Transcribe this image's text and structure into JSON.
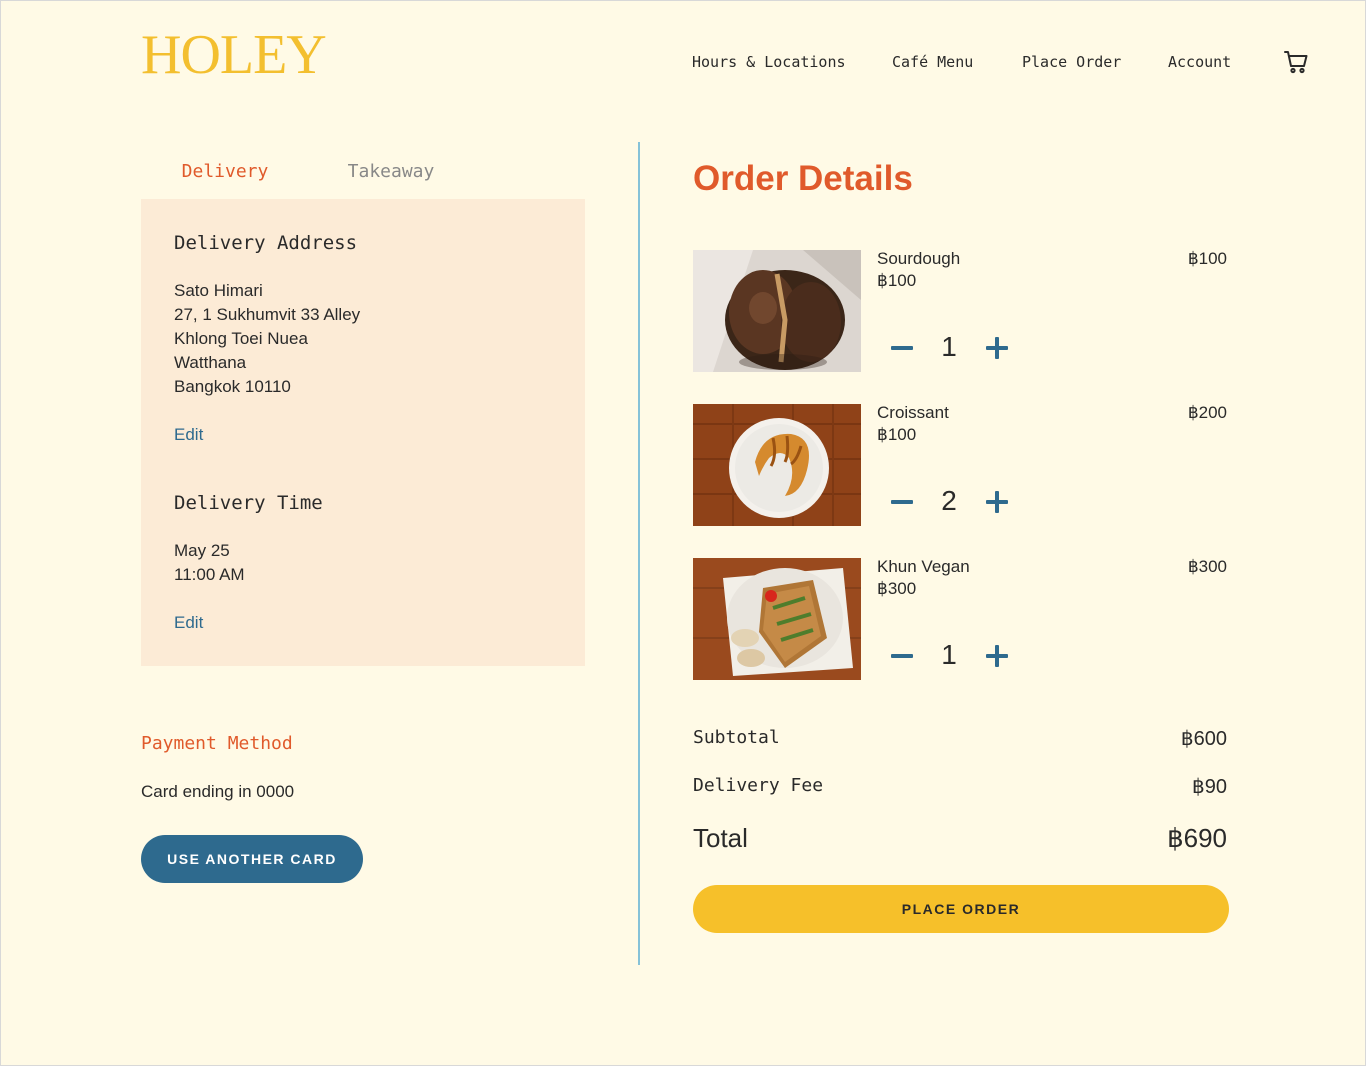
{
  "header": {
    "logo": "HOLEY",
    "nav": [
      {
        "label": "Hours & Locations"
      },
      {
        "label": "Café Menu"
      },
      {
        "label": "Place Order"
      },
      {
        "label": "Account"
      }
    ],
    "cart_icon": "cart-icon"
  },
  "tabs": [
    {
      "label": "Delivery",
      "active": true
    },
    {
      "label": "Takeaway",
      "active": false
    }
  ],
  "delivery": {
    "address_heading": "Delivery Address",
    "address_lines": [
      "Sato Himari",
      "27, 1 Sukhumvit 33 Alley",
      "Khlong Toei Nuea",
      "Watthana",
      "Bangkok 10110"
    ],
    "edit_label": "Edit",
    "time_heading": "Delivery Time",
    "time_lines": [
      "May 25",
      "11:00 AM"
    ]
  },
  "payment": {
    "title": "Payment Method",
    "card_text": "Card ending in 0000",
    "another_card_label": "USE ANOTHER CARD"
  },
  "order": {
    "title": "Order Details",
    "items": [
      {
        "name": "Sourdough",
        "unit_price": "฿100",
        "quantity": "1",
        "line_total": "฿100",
        "image": "sourdough-bread-photo"
      },
      {
        "name": "Croissant",
        "unit_price": "฿100",
        "quantity": "2",
        "line_total": "฿200",
        "image": "croissant-photo"
      },
      {
        "name": "Khun Vegan",
        "unit_price": "฿300",
        "quantity": "1",
        "line_total": "฿300",
        "image": "vegan-sandwich-photo"
      }
    ],
    "subtotal_label": "Subtotal",
    "subtotal_value": "฿600",
    "delivery_fee_label": "Delivery Fee",
    "delivery_fee_value": "฿90",
    "total_label": "Total",
    "total_value": "฿690",
    "place_order_label": "PLACE ORDER"
  },
  "colors": {
    "background": "#fffae6",
    "accent_orange": "#e05a2b",
    "accent_blue": "#2e6a8e",
    "logo_yellow": "#f3bf2f",
    "button_yellow": "#f6c02a",
    "panel": "#fcebd6",
    "divider": "#86c2d8"
  }
}
